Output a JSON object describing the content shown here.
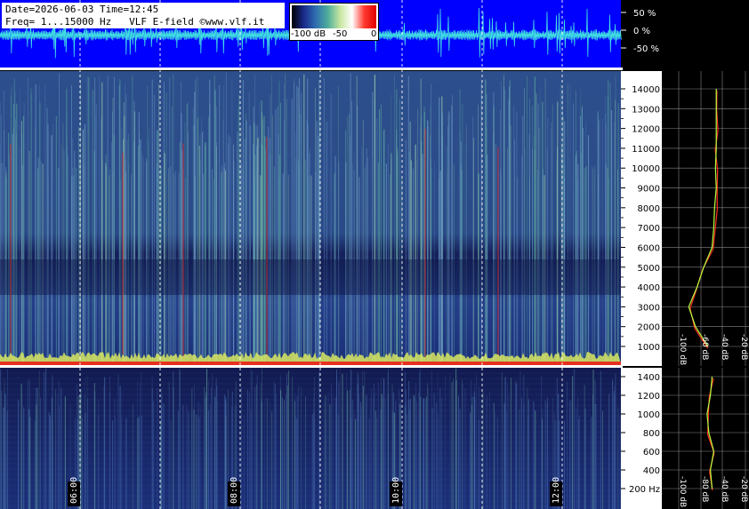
{
  "header": {
    "line1": "Date=2026-06-03 Time=12:45",
    "line2": "Freq= 1...15000 Hz   VLF E-field ©www.vlf.it"
  },
  "colorbar": {
    "labels": [
      "-100 dB",
      "-50",
      "0"
    ],
    "stops": [
      "#000000",
      "#1a2a8c",
      "#2f6fb0",
      "#4fae9a",
      "#c8e6a0",
      "#ffffff",
      "#ff3b30",
      "#e00000"
    ]
  },
  "waveform": {
    "labels": [
      "50 %",
      "0 %",
      "-50 %"
    ],
    "bg": "#0000ff",
    "trace": "#40e0e0"
  },
  "spectrogram_main": {
    "freq_ticks": [
      "14000",
      "13000",
      "12000",
      "11000",
      "10000",
      "9000",
      "8000",
      "7000",
      "6000",
      "5000",
      "4000",
      "3000",
      "2000",
      "1000"
    ]
  },
  "spectrogram_low": {
    "freq_ticks": [
      "1400",
      "1200",
      "1000",
      "800",
      "600",
      "400",
      "200 Hz"
    ]
  },
  "time_labels": [
    "06:00",
    "08:00",
    "10:00",
    "12:00"
  ],
  "spectrum_axis": {
    "main": [
      "-100 dB",
      "-60 dB",
      "-40 dB",
      "-20 dB"
    ],
    "low": [
      "-100 dB",
      "-80 dB",
      "-40 dB",
      "-20 dB"
    ]
  },
  "colors": {
    "axis_bg": "#ffffff",
    "spectrum_green": "#b8ff40",
    "spectrum_red": "#ff3020"
  },
  "chart_data": {
    "type": "heatmap",
    "title": "",
    "xlabel": "",
    "ylabel": "",
    "x_ticks": [
      "06:00",
      "08:00",
      "10:00",
      "12:00"
    ],
    "y_range_main_hz": [
      1,
      15000
    ],
    "y_range_low_hz": [
      1,
      1500
    ],
    "colorbar_db": [
      -100,
      0
    ],
    "spectrum_profile_main": {
      "freq_hz": [
        1000,
        2000,
        3000,
        4000,
        5000,
        6000,
        7000,
        8000,
        9000,
        10000,
        11000,
        12000,
        13000,
        14000
      ],
      "level_db": [
        -65,
        -80,
        -88,
        -78,
        -70,
        -60,
        -58,
        -57,
        -55,
        -56,
        -55,
        -55,
        -55,
        -55
      ]
    },
    "spectrum_profile_low": {
      "freq_hz": [
        200,
        400,
        600,
        800,
        1000,
        1200,
        1400
      ],
      "level_db": [
        -60,
        -62,
        -58,
        -64,
        -66,
        -62,
        -60
      ]
    }
  }
}
